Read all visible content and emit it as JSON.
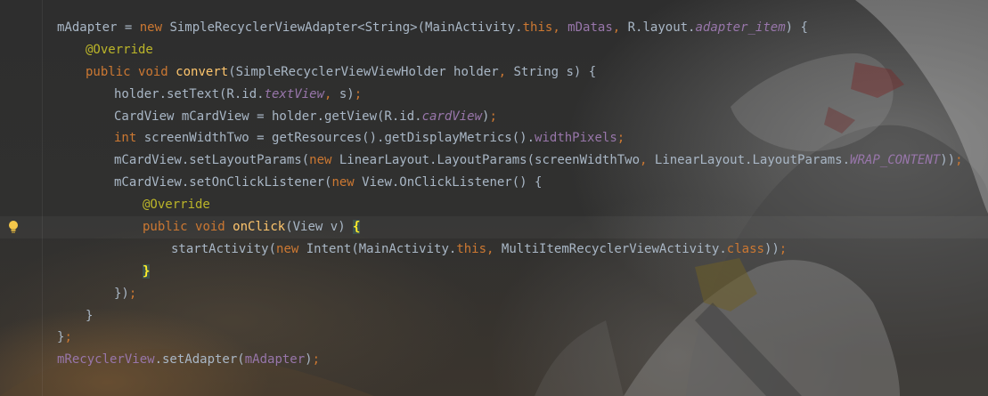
{
  "editor": {
    "language": "java",
    "theme": "dark",
    "colors": {
      "background": "#2b2b2b",
      "text": "#a9b7c6",
      "keyword": "#cc7832",
      "annotation": "#bbb529",
      "method": "#ffc66d",
      "field": "#9876aa"
    },
    "gutter_icon": "lightbulb-icon",
    "lines": [
      {
        "t1": "mAdapter = ",
        "kw1": "new",
        "t2": " SimpleRecyclerViewAdapter<String>(MainActivity.",
        "kw2": "this",
        "p1": ",",
        "f1": " mDatas",
        "p2": ",",
        "t3": " R.layout.",
        "f2": "adapter_item",
        "t4": ") {"
      },
      {
        "ann": "@Override"
      },
      {
        "kw1": "public",
        "t1": " ",
        "kw2": "void",
        "t2": " ",
        "fn": "convert",
        "t3": "(SimpleRecyclerViewViewHolder holder",
        "p1": ",",
        "t4": " String s) {"
      },
      {
        "t1": "holder.setText(R.id.",
        "f1": "textView",
        "p1": ",",
        "t2": " s)",
        "p2": ";"
      },
      {
        "t1": "CardView mCardView = holder.getView(R.id.",
        "f1": "cardView",
        "t2": ")",
        "p1": ";"
      },
      {
        "kw1": "int",
        "t1": " screenWidthTwo = getResources().getDisplayMetrics().",
        "f1": "widthPixels",
        "p1": ";"
      },
      {
        "t1": "mCardView.setLayoutParams(",
        "kw1": "new",
        "t2": " LinearLayout.LayoutParams(screenWidthTwo",
        "p1": ",",
        "t3": " LinearLayout.LayoutParams.",
        "f1": "WRAP_CONTENT",
        "t4": "))",
        "p2": ";"
      },
      {
        "t1": "mCardView.setOnClickListener(",
        "kw1": "new",
        "t2": " View.OnClickListener() {"
      },
      {
        "ann": "@Override"
      },
      {
        "kw1": "public",
        "t1": " ",
        "kw2": "void",
        "t2": " ",
        "fn": "onClick",
        "t3": "(View v) ",
        "brace": "{"
      },
      {
        "t1": "startActivity(",
        "kw1": "new",
        "t2": " Intent(MainActivity.",
        "kw2": "this",
        "p1": ",",
        "t3": " MultiItemRecyclerViewActivity.",
        "kw3": "class",
        "t4": "))",
        "p2": ";"
      },
      {
        "brace": "}"
      },
      {
        "t1": "})",
        "p1": ";"
      },
      {
        "t1": "}"
      },
      {
        "t1": "}",
        "p1": ";"
      },
      {
        "f1": "mRecyclerView",
        "t1": ".setAdapter(",
        "f2": "mAdapter",
        "t2": ")",
        "p1": ";"
      }
    ]
  }
}
